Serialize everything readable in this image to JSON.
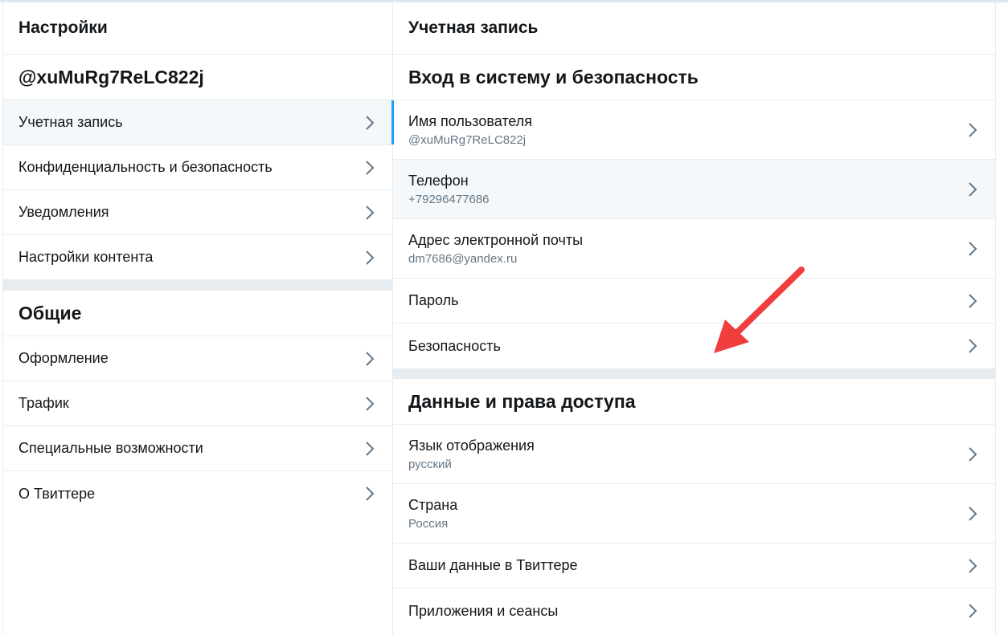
{
  "left": {
    "header": "Настройки",
    "account_handle": "@xuMuRg7ReLC822j",
    "account_items": [
      {
        "label": "Учетная запись"
      },
      {
        "label": "Конфиденциальность и безопасность"
      },
      {
        "label": "Уведомления"
      },
      {
        "label": "Настройки контента"
      }
    ],
    "general_title": "Общие",
    "general_items": [
      {
        "label": "Оформление"
      },
      {
        "label": "Трафик"
      },
      {
        "label": "Специальные возможности"
      },
      {
        "label": "О Твиттере"
      }
    ]
  },
  "right": {
    "header": "Учетная запись",
    "login_title": "Вход в систему и безопасность",
    "login_items": [
      {
        "label": "Имя пользователя",
        "value": "@xuMuRg7ReLC822j"
      },
      {
        "label": "Телефон",
        "value": "+79296477686"
      },
      {
        "label": "Адрес электронной почты",
        "value": "dm7686@yandex.ru"
      },
      {
        "label": "Пароль"
      },
      {
        "label": "Безопасность"
      }
    ],
    "data_title": "Данные и права доступа",
    "data_items": [
      {
        "label": "Язык отображения",
        "value": "русский"
      },
      {
        "label": "Страна",
        "value": "Россия"
      },
      {
        "label": "Ваши данные в Твиттере"
      },
      {
        "label": "Приложения и сеансы"
      }
    ]
  },
  "colors": {
    "accent": "#1da1f2",
    "annotation_arrow": "#f03e3e",
    "divider": "#e6ecf0",
    "hover_bg": "#f5f8fa",
    "secondary_text": "#657786"
  }
}
